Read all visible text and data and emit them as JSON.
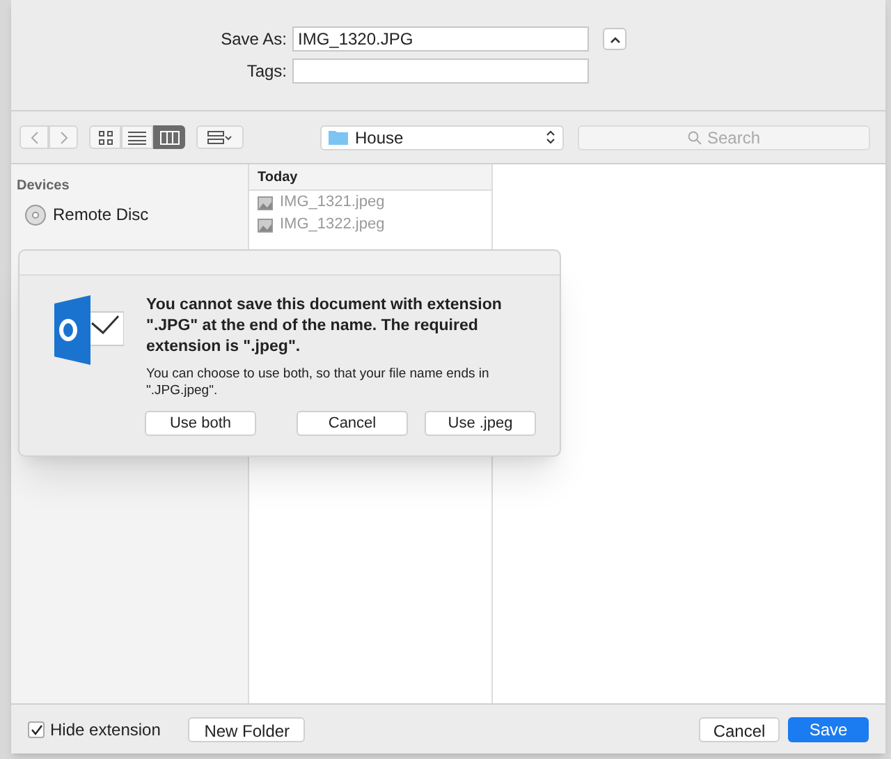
{
  "save_as": {
    "label": "Save As:",
    "value": "IMG_1320.JPG"
  },
  "tags": {
    "label": "Tags:"
  },
  "view_modes": [
    {
      "kind": "icons",
      "selected": false
    },
    {
      "kind": "list",
      "selected": false
    },
    {
      "kind": "columns",
      "selected": true
    }
  ],
  "location": {
    "label": "House"
  },
  "search": {
    "placeholder": "Search"
  },
  "sidebar": {
    "section": "Devices",
    "items": [
      {
        "label": "Remote Disc"
      }
    ]
  },
  "column": {
    "header": "Today",
    "files": [
      {
        "name": "IMG_1321.jpeg"
      },
      {
        "name": "IMG_1322.jpeg"
      }
    ]
  },
  "alert": {
    "title": "You cannot save this document with extension \".JPG\" at the end of the name. The required extension is \".jpeg\".",
    "message": "You can choose to use both, so that your file name ends in \".JPG.jpeg\".",
    "buttons": [
      {
        "label": "Use both"
      },
      {
        "label": "Cancel"
      },
      {
        "label": "Use .jpeg"
      }
    ]
  },
  "footer": {
    "hide_extension": {
      "label": "Hide extension",
      "checked": true
    },
    "new_folder": "New Folder",
    "cancel": "Cancel",
    "save": "Save"
  }
}
